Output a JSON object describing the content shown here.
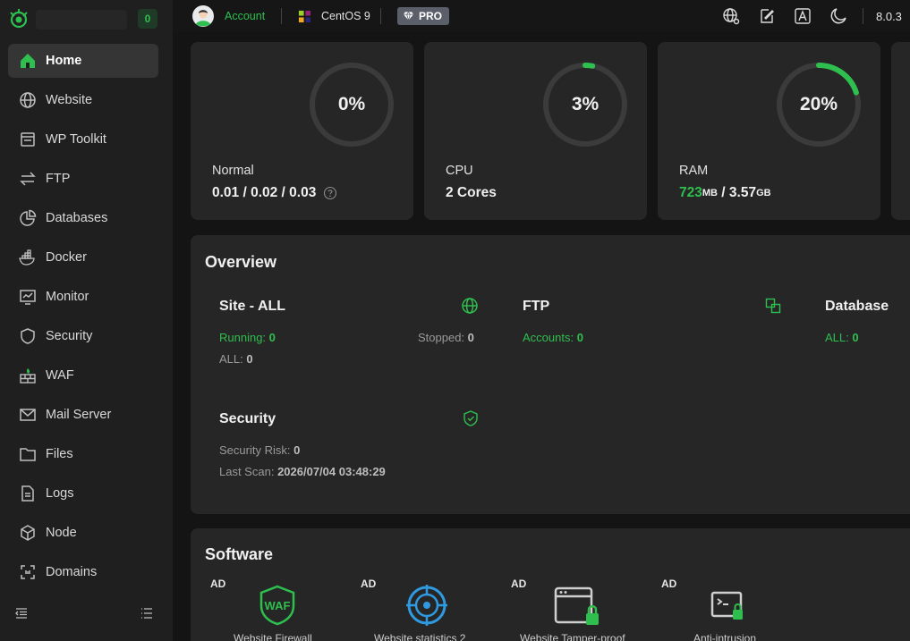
{
  "sidebar": {
    "alert_count": "0",
    "items": [
      {
        "label": "Home"
      },
      {
        "label": "Website"
      },
      {
        "label": "WP Toolkit"
      },
      {
        "label": "FTP"
      },
      {
        "label": "Databases"
      },
      {
        "label": "Docker"
      },
      {
        "label": "Monitor"
      },
      {
        "label": "Security"
      },
      {
        "label": "WAF"
      },
      {
        "label": "Mail Server"
      },
      {
        "label": "Files"
      },
      {
        "label": "Logs"
      },
      {
        "label": "Node"
      },
      {
        "label": "Domains"
      }
    ]
  },
  "topbar": {
    "account": "Account",
    "os": "CentOS 9",
    "pro": "PRO",
    "version": "8.0.3"
  },
  "stats": {
    "load": {
      "percent_text": "0%",
      "percent": 0,
      "label": "Normal",
      "value": "0.01 / 0.02 / 0.03"
    },
    "cpu": {
      "percent_text": "3%",
      "percent": 3,
      "label": "CPU",
      "value": "2 Cores"
    },
    "ram": {
      "percent_text": "20%",
      "percent": 20,
      "label": "RAM",
      "used": "723",
      "used_unit": "MB",
      "sep": " / ",
      "total": "3.57",
      "total_unit": "GB"
    }
  },
  "overview": {
    "title": "Overview",
    "site": {
      "title": "Site - ALL",
      "running_label": "Running:",
      "running": "0",
      "stopped_label": "Stopped:",
      "stopped": "0",
      "all_label": "ALL:",
      "all": "0"
    },
    "ftp": {
      "title": "FTP",
      "accounts_label": "Accounts:",
      "accounts": "0"
    },
    "database": {
      "title": "Database",
      "all_label": "ALL:",
      "all": "0"
    },
    "security": {
      "title": "Security",
      "risk_label": "Security Risk:",
      "risk": "0",
      "scan_label": "Last Scan:",
      "scan": "2026/07/04 03:48:29"
    }
  },
  "software": {
    "title": "Software",
    "items": [
      {
        "ad": "AD",
        "name": "Website Firewall"
      },
      {
        "ad": "AD",
        "name": "Website statistics 2"
      },
      {
        "ad": "AD",
        "name": "Website Tamper-proof"
      },
      {
        "ad": "AD",
        "name": "Anti-intrusion"
      }
    ]
  },
  "colors": {
    "accent": "#2fbf4f",
    "background": "#141414",
    "card": "#262626",
    "sidebar": "#1f1f1f"
  }
}
